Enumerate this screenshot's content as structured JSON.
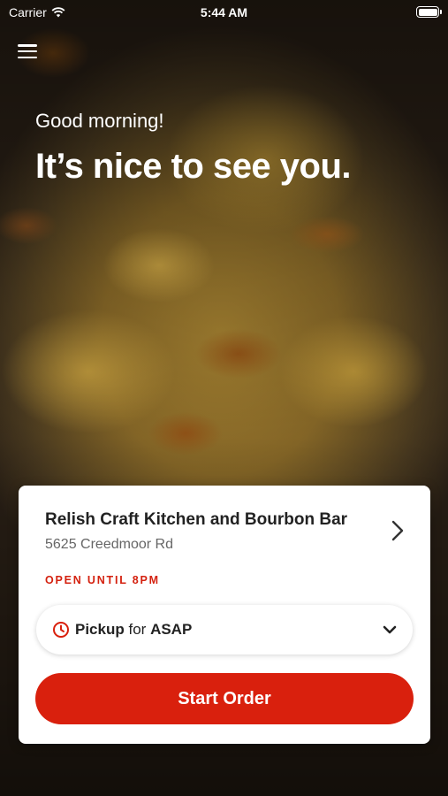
{
  "status_bar": {
    "carrier": "Carrier",
    "time": "5:44 AM",
    "battery_level": 1.0
  },
  "header": {
    "menu_icon": "hamburger-menu-icon",
    "greeting": "Good morning!",
    "headline": "It’s nice to see you."
  },
  "store_card": {
    "name": "Relish Craft Kitchen and Bourbon Bar",
    "address": "5625 Creedmoor Rd",
    "open_status": "OPEN UNTIL 8PM",
    "status_color": "#d4210f",
    "pickup": {
      "mode": "Pickup",
      "connector": "for",
      "time": "ASAP",
      "icon": "clock-icon"
    },
    "start_label": "Start Order",
    "accent_color": "#d9200d"
  }
}
